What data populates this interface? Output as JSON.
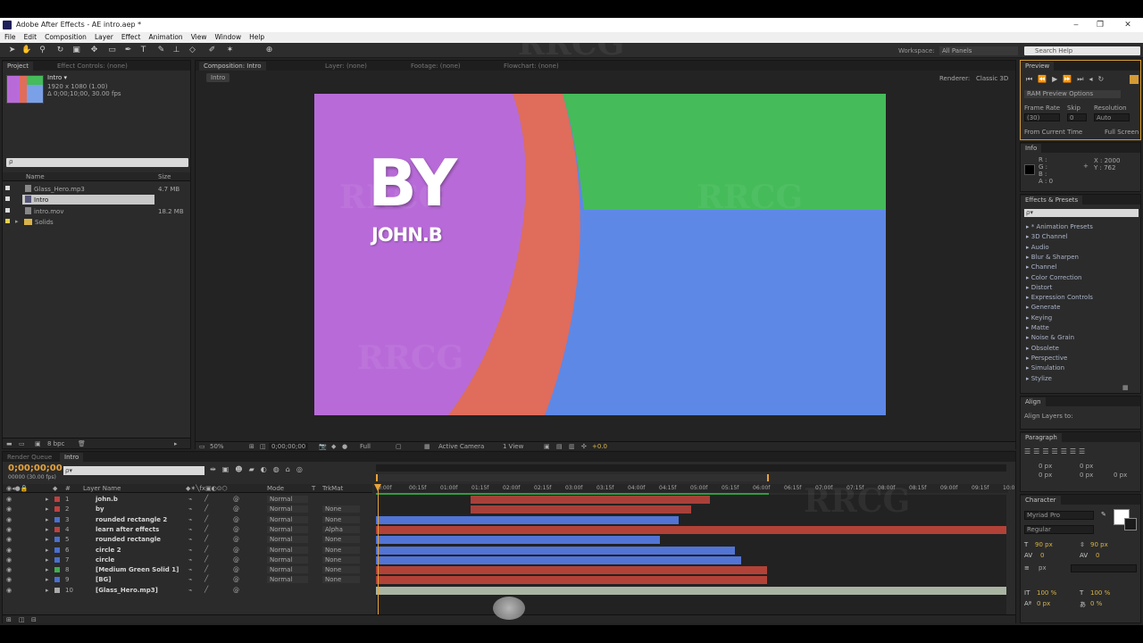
{
  "window": {
    "title": "Adobe After Effects - AE intro.aep *"
  },
  "menu": [
    "File",
    "Edit",
    "Composition",
    "Layer",
    "Effect",
    "Animation",
    "View",
    "Window",
    "Help"
  ],
  "toolbar": {
    "workspace_label": "Workspace:",
    "workspace_value": "All Panels",
    "search_placeholder": "Search Help"
  },
  "project": {
    "tabs": [
      "Project",
      "Effect Controls: (none)"
    ],
    "comp_name": "Intro ▾",
    "comp_info1": "1920 x 1080 (1.00)",
    "comp_info2": "Δ 0;00;10;00, 30.00 fps",
    "col_name": "Name",
    "col_size": "Size",
    "items": [
      {
        "name": "Glass_Hero.mp3",
        "size": "4.7 MB"
      },
      {
        "name": "Intro",
        "size": ""
      },
      {
        "name": "intro.mov",
        "size": "18.2 MB"
      },
      {
        "name": "Solids",
        "size": ""
      }
    ],
    "bpc": "8 bpc"
  },
  "comp": {
    "tabs": [
      "Composition: Intro",
      "Layer: (none)",
      "Footage: (none)",
      "Flowchart: (none)"
    ],
    "breadcrumb": "Intro",
    "renderer_label": "Renderer:",
    "renderer_value": "Classic 3D",
    "text_big": "BY",
    "text_small": "JOHN.B",
    "zoom": "50%",
    "timecode": "0;00;00;00",
    "quality": "Full",
    "camera": "Active Camera",
    "view": "1 View",
    "exposure": "+0.0"
  },
  "timeline": {
    "tabs": [
      "Render Queue",
      "Intro"
    ],
    "timecode": "0;00;00;00",
    "frames": "00000 (30.00 fps)",
    "search_placeholder": "ρ▾",
    "col_num": "#",
    "col_layer": "Layer Name",
    "col_mode": "Mode",
    "col_t": "T",
    "col_trkmat": "TrkMat",
    "ruler": [
      "0:00f",
      "00:15f",
      "01:00f",
      "01:15f",
      "02:00f",
      "02:15f",
      "03:00f",
      "03:15f",
      "04:00f",
      "04:15f",
      "05:00f",
      "05:15f",
      "06:00f",
      "06:15f",
      "07:00f",
      "07:15f",
      "08:00f",
      "08:15f",
      "09:00f",
      "09:15f",
      "10:0"
    ],
    "layers": [
      {
        "num": "1",
        "name": "john.b",
        "mode": "Normal",
        "trkmat": "",
        "color": "#c04040",
        "start": 0.15,
        "end": 0.53,
        "bar": "#a8403a"
      },
      {
        "num": "2",
        "name": "by",
        "mode": "Normal",
        "trkmat": "None",
        "color": "#c04040",
        "start": 0.15,
        "end": 0.5,
        "bar": "#a8403a"
      },
      {
        "num": "3",
        "name": "rounded rectangle 2",
        "mode": "Normal",
        "trkmat": "None",
        "color": "#4a6fd0",
        "start": 0.0,
        "end": 0.48,
        "bar": "#5274d4"
      },
      {
        "num": "4",
        "name": "learn after effects",
        "mode": "Normal",
        "trkmat": "Alpha",
        "color": "#c04040",
        "start": 0.0,
        "end": 1.0,
        "bar": "#b24238"
      },
      {
        "num": "5",
        "name": "rounded rectangle",
        "mode": "Normal",
        "trkmat": "None",
        "color": "#4a6fd0",
        "start": 0.0,
        "end": 0.45,
        "bar": "#5274d4"
      },
      {
        "num": "6",
        "name": "circle 2",
        "mode": "Normal",
        "trkmat": "None",
        "color": "#4a6fd0",
        "start": 0.0,
        "end": 0.57,
        "bar": "#5274d4"
      },
      {
        "num": "7",
        "name": "circle",
        "mode": "Normal",
        "trkmat": "None",
        "color": "#4a6fd0",
        "start": 0.0,
        "end": 0.58,
        "bar": "#5274d4"
      },
      {
        "num": "8",
        "name": "[Medium Green Solid 1]",
        "mode": "Normal",
        "trkmat": "None",
        "color": "#3fae4f",
        "start": 0.0,
        "end": 0.62,
        "bar": "#b24238"
      },
      {
        "num": "9",
        "name": "[BG]",
        "mode": "Normal",
        "trkmat": "None",
        "color": "#4a6fd0",
        "start": 0.0,
        "end": 0.62,
        "bar": "#b24238"
      },
      {
        "num": "10",
        "name": "[Glass_Hero.mp3]",
        "mode": "",
        "trkmat": "",
        "color": "#aaaaaa",
        "start": 0.0,
        "end": 1.0,
        "bar": "#a9b5a2"
      }
    ]
  },
  "preview": {
    "tab": "Preview",
    "ram": "RAM Preview Options",
    "frame_rate_label": "Frame Rate",
    "frame_rate": "(30)",
    "skip_label": "Skip",
    "skip": "0",
    "resolution_label": "Resolution",
    "resolution": "Auto",
    "from_current": "From Current Time",
    "full_screen": "Full Screen"
  },
  "info": {
    "tab": "Info",
    "r": "R :",
    "g": "G :",
    "b": "B :",
    "a": "A : 0",
    "x": "X : 2000",
    "y": "Y : 762"
  },
  "effects": {
    "tab": "Effects & Presets",
    "search_placeholder": "ρ▾",
    "items": [
      "* Animation Presets",
      "3D Channel",
      "Audio",
      "Blur & Sharpen",
      "Channel",
      "Color Correction",
      "Distort",
      "Expression Controls",
      "Generate",
      "Keying",
      "Matte",
      "Noise & Grain",
      "Obsolete",
      "Perspective",
      "Simulation",
      "Stylize"
    ]
  },
  "align": {
    "tab": "Align",
    "label": "Align Layers to:"
  },
  "paragraph": {
    "tab": "Paragraph",
    "px1": "0 px",
    "px2": "0 px",
    "px3": "0 px",
    "px4": "0 px",
    "px5": "0 px"
  },
  "character": {
    "tab": "Character",
    "font": "Myriad Pro",
    "style": "Regular",
    "size": "90 px",
    "leading": "90 px",
    "kerning": "0",
    "tracking": "0",
    "px": "px",
    "scale_v": "100 %",
    "scale_h": "100 %",
    "baseline": "0 px",
    "tsume": "0 %"
  },
  "colors": {
    "panel_bg": "#2b2b2b",
    "accent": "#e8a33a",
    "purple": "#b86bd8",
    "red": "#e06c5c",
    "green": "#45bb5a",
    "blue": "#5e88e6"
  }
}
